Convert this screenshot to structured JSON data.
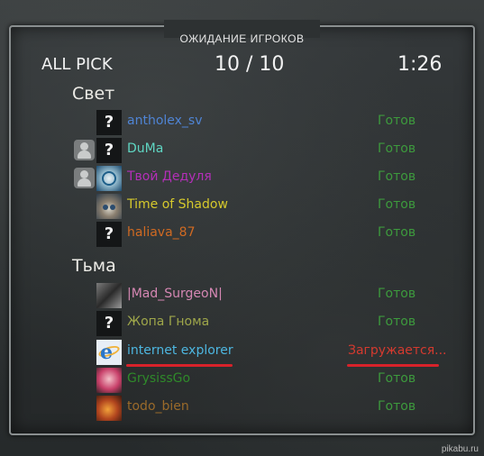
{
  "header": {
    "waiting": "ОЖИДАНИЕ ИГРОКОВ",
    "mode": "ALL PICK",
    "count": "10 / 10",
    "timer": "1:26"
  },
  "teams": [
    {
      "title": "Свет",
      "players": [
        {
          "name": "antholex_sv",
          "status": "Готов",
          "avatar": "question-mark",
          "color": "#4f84d4",
          "badge": false
        },
        {
          "name": "DuMa",
          "status": "Готов",
          "avatar": "question-mark",
          "color": "#5fd6c3",
          "badge": true
        },
        {
          "name": "Твой Дедуля",
          "status": "Готов",
          "avatar": "dota-logo",
          "color": "#b32fb8",
          "badge": true
        },
        {
          "name": "Time of Shadow",
          "status": "Готов",
          "avatar": "cat-photo",
          "color": "#d6c92c",
          "badge": false
        },
        {
          "name": "haliava_87",
          "status": "Готов",
          "avatar": "question-mark",
          "color": "#d06a22",
          "badge": false
        }
      ]
    },
    {
      "title": "Тьма",
      "players": [
        {
          "name": "|Mad_SurgeoN|",
          "status": "Готов",
          "avatar": "shadow-figure",
          "color": "#d587b3",
          "badge": false
        },
        {
          "name": "Жопа Гнома",
          "status": "Готов",
          "avatar": "question-mark",
          "color": "#9ea64a",
          "badge": false
        },
        {
          "name": "internet explorer",
          "status": "Загружается...",
          "avatar": "ie-logo",
          "color": "#4db6e0",
          "badge": false
        },
        {
          "name": "GrysissGo",
          "status": "Готов",
          "avatar": "pink-face",
          "color": "#2f8a2a",
          "badge": false
        },
        {
          "name": "todo_bien",
          "status": "Готов",
          "avatar": "fire-face",
          "color": "#9a6a2a",
          "badge": false
        }
      ]
    }
  ],
  "question_mark": "?",
  "watermark": "pikabu.ru",
  "colors": {
    "ready": "#3d9a3d",
    "loading": "#d43a2f",
    "underline": "#d8222a"
  }
}
